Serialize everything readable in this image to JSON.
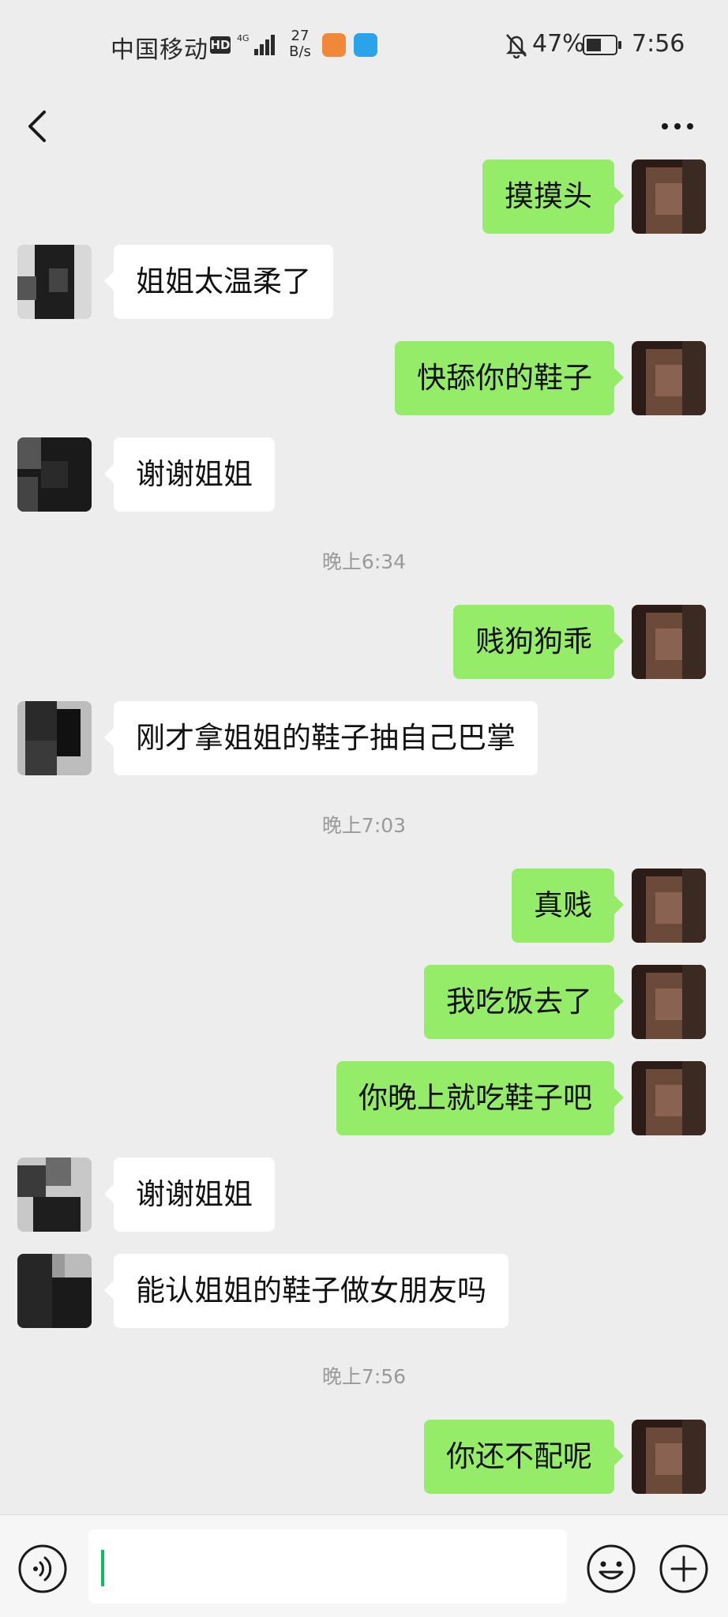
{
  "status_bar": {
    "carrier": "中国移动",
    "hd_badge": "HD",
    "network_speed_value": "27",
    "network_speed_unit": "B/s",
    "battery_percent": "47%",
    "time": "7:56"
  },
  "header": {
    "back_icon": "chevron-left-icon",
    "more_icon": "more-dots-icon"
  },
  "messages": [
    {
      "type": "out",
      "text": "摸摸头"
    },
    {
      "type": "in",
      "text": "姐姐太温柔了"
    },
    {
      "type": "out",
      "text": "快舔你的鞋子"
    },
    {
      "type": "in",
      "text": "谢谢姐姐"
    },
    {
      "type": "time",
      "text": "晚上6:34"
    },
    {
      "type": "out",
      "text": "贱狗狗乖"
    },
    {
      "type": "in",
      "text": "刚才拿姐姐的鞋子抽自己巴掌"
    },
    {
      "type": "time",
      "text": "晚上7:03"
    },
    {
      "type": "out",
      "text": "真贱"
    },
    {
      "type": "out",
      "text": "我吃饭去了"
    },
    {
      "type": "out",
      "text": "你晚上就吃鞋子吧"
    },
    {
      "type": "in",
      "text": "谢谢姐姐"
    },
    {
      "type": "in",
      "text": "能认姐姐的鞋子做女朋友吗"
    },
    {
      "type": "time",
      "text": "晚上7:56"
    },
    {
      "type": "out",
      "text": "你还不配呢"
    }
  ],
  "input_bar": {
    "voice_icon": "voice-icon",
    "emoji_icon": "emoji-icon",
    "plus_icon": "plus-icon",
    "text_value": ""
  },
  "colors": {
    "background": "#ededed",
    "bubble_out": "#95ec69",
    "bubble_in": "#ffffff",
    "accent": "#07c160"
  }
}
